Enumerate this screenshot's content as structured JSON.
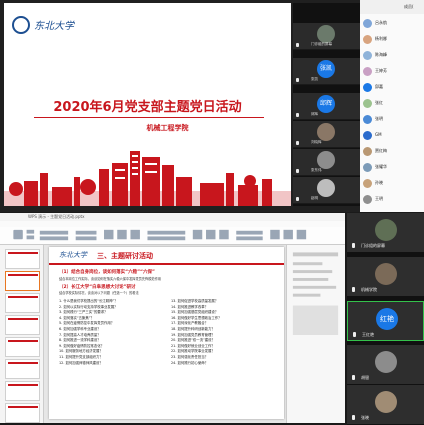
{
  "top": {
    "slide": {
      "logo_text": "东北大学",
      "title": "2020年6月党支部主题党日活动",
      "subtitle": "机械工程学院"
    },
    "participants": [
      {
        "name": "门诊组的屏幕",
        "type": "photo"
      },
      {
        "name": "张凯",
        "type": "avatar",
        "avatar_text": "张凯"
      },
      {
        "name": "邱辉",
        "type": "avatar",
        "avatar_text": "邱辉"
      },
      {
        "name": "刘晓辉",
        "type": "photo"
      },
      {
        "name": "张东伟",
        "type": "photo"
      },
      {
        "name": "王连",
        "type": "photo"
      },
      {
        "name": "赵明",
        "type": "photo"
      }
    ],
    "member_list": {
      "header": "成员(",
      "items": [
        {
          "label": "吕永航",
          "color": "#7fa6d8"
        },
        {
          "label": "杨利娜",
          "color": "#d8a47f"
        },
        {
          "label": "陈海峰",
          "color": "#8fb3d9"
        },
        {
          "label": "王婷芳",
          "color": "#c9a0c4"
        },
        {
          "label": "邱嘉",
          "color": "#1a78e6"
        },
        {
          "label": "张红",
          "color": "#9cc38f"
        },
        {
          "label": "张明",
          "color": "#4a8ad6"
        },
        {
          "label": "GM",
          "color": "#2a6bcc"
        },
        {
          "label": "贾红梅",
          "color": "#b99873"
        },
        {
          "label": "张耀华",
          "color": "#7c9bb8"
        },
        {
          "label": "孙晓",
          "color": "#c7a27a"
        },
        {
          "label": "王明",
          "color": "#8f8f8f"
        }
      ]
    }
  },
  "bottom": {
    "wps": {
      "title": "WPS 演示 - 主题党日活动.pptx",
      "menu": [
        "文件",
        "开始",
        "插入",
        "设计",
        "切换",
        "动画",
        "放映",
        "审阅",
        "视图",
        "工具"
      ],
      "thumb_count": 8
    },
    "slide": {
      "logo_text": "东北大学",
      "title": "三、主题研讨活动",
      "sec1_title": "（1）结合自身岗位，谈如何落实“六稳”“六保”",
      "sec1_body": "结合本岗位工作实际，谈谈如何在落实六稳六保中发挥党员先锋模范作用",
      "sec2_title": "（2）长江大学“白阜思想大讨论”研讨",
      "sec2_body": "结合学校实际情况，谈谈对以下问题（任选一个）的看法",
      "questions_left": [
        "1. 什么是我们学校提出的“长江精神”？",
        "2. 如何以实际行动支持学校事业发展？",
        "3. 如何践行“三严三实”的要求？",
        "4. 如何落实“五聚焦”？",
        "5. 如何在疫情防控中发挥党员作用？",
        "6. 如何加强学科专业建设？",
        "7. 如何提高人才培养质量？",
        "8. 如何推进一流学科建设？",
        "9. 如何做好疫情防控常态化？",
        "10. 如何服务地方经济发展？",
        "11. 如何提升党支部组织力？",
        "12. 如何加强师德师风建设？"
      ],
      "questions_right": [
        "13. 如何促进学校高质量发展？",
        "14. 如何推进教学改革？",
        "15. 如何加强基层党组织建设？",
        "16. 如何做好学生思想政治工作？",
        "17. 如何深化产教融合？",
        "18. 如何提升科研创新能力？",
        "19. 如何加强党员教育管理？",
        "20. 如何推进“双一流”建设？",
        "21. 如何做好就业创业工作？",
        "22. 如何推动学院事业发展？",
        "23. 如何强化责任担当？",
        "24. 如何践行初心使命？"
      ]
    },
    "videos": [
      {
        "name": "门诊组的屏幕",
        "type": "photo",
        "active": false
      },
      {
        "name": "机械学院",
        "type": "photo",
        "active": false
      },
      {
        "name": "王红艳",
        "type": "avatar",
        "avatar_text": "红艳",
        "active": true
      },
      {
        "name": "胡银",
        "type": "photo",
        "active": false
      },
      {
        "name": "张晓",
        "type": "photo",
        "active": false
      }
    ]
  }
}
